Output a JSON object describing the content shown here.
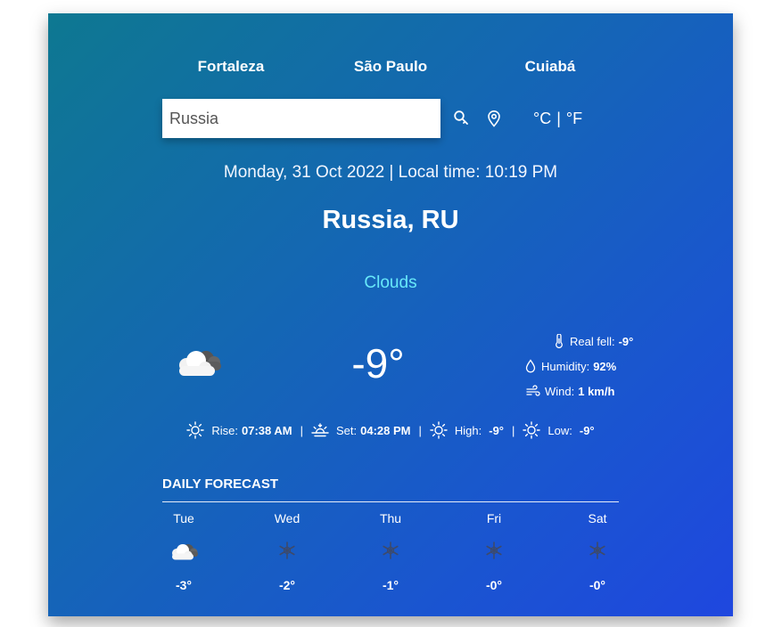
{
  "cities": [
    "Fortaleza",
    "São Paulo",
    "Cuiabá"
  ],
  "search": {
    "value": "Russia"
  },
  "units": {
    "celsius": "°C",
    "separator": "|",
    "fahrenheit": "°F"
  },
  "datetime": "Monday, 31 Oct 2022 | Local time: 10:19 PM",
  "location": "Russia, RU",
  "condition": "Clouds",
  "temperature": "-9°",
  "details": {
    "real_feel_label": "Real fell:",
    "real_feel_value": "-9°",
    "humidity_label": "Humidity:",
    "humidity_value": "92%",
    "wind_label": "Wind:",
    "wind_value": "1 km/h"
  },
  "sun": {
    "rise_label": "Rise:",
    "rise_value": "07:38 AM",
    "set_label": "Set:",
    "set_value": "04:28 PM",
    "high_label": "High:",
    "high_value": "-9°",
    "low_label": "Low:",
    "low_value": "-9°",
    "separator": "|"
  },
  "forecast_title": "DAILY FORECAST",
  "forecast": [
    {
      "day": "Tue",
      "temp": "-3°",
      "icon": "clouds-icon"
    },
    {
      "day": "Wed",
      "temp": "-2°",
      "icon": "snow-icon"
    },
    {
      "day": "Thu",
      "temp": "-1°",
      "icon": "snow-icon"
    },
    {
      "day": "Fri",
      "temp": "-0°",
      "icon": "snow-icon"
    },
    {
      "day": "Sat",
      "temp": "-0°",
      "icon": "snow-icon"
    }
  ],
  "colors": {
    "condition": "#67e8f9",
    "gradient_start": "#0e7891",
    "gradient_end": "#1f47df"
  }
}
